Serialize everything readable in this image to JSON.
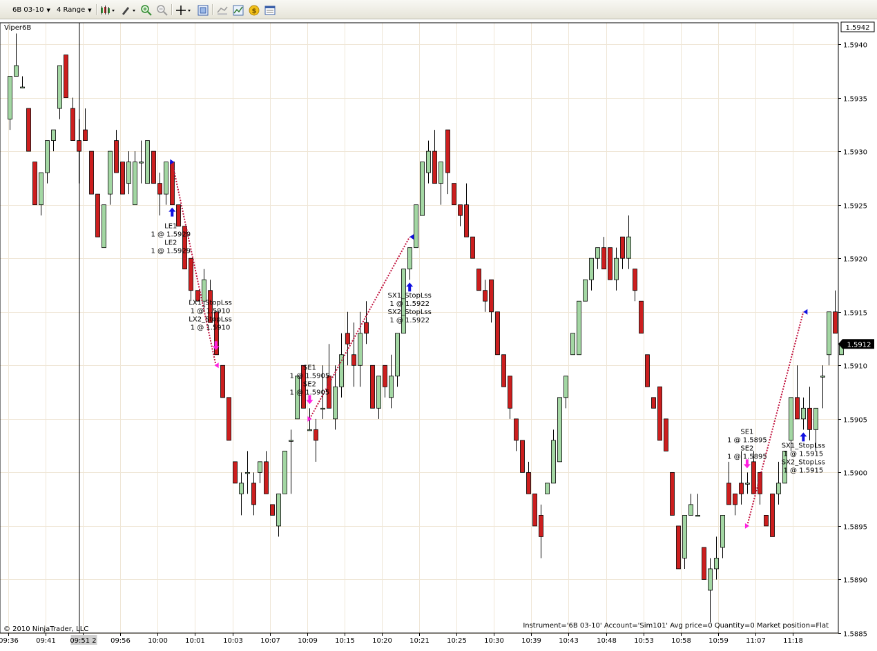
{
  "toolbar": {
    "instrument": "6B 03-10",
    "period": "4 Range"
  },
  "chart_title": "Viper6B",
  "colors": {
    "up_candle": "#a3d7a3",
    "down_candle": "#cc1e1e",
    "trade_line": "#c0103c",
    "long_marker": "#1010e0",
    "short_marker": "#ff20e0",
    "grid": "#efe6d6"
  },
  "chart_data": {
    "type": "candlestick",
    "price_axis": {
      "ylim": [
        1.5885,
        1.5942
      ],
      "ticks": [
        "1.5885",
        "1.5890",
        "1.5895",
        "1.5900",
        "1.5905",
        "1.5910",
        "1.5915",
        "1.5920",
        "1.5925",
        "1.5930",
        "1.5935",
        "1.5940"
      ],
      "top_label": "1.5942",
      "last_price_label": "1.5912",
      "last_price": 1.5912
    },
    "time_axis": {
      "ticks": [
        "09:36",
        "09:41",
        "09:51 2",
        "09:56",
        "10:00",
        "10:01",
        "10:03",
        "10:07",
        "10:09",
        "10:15",
        "10:20",
        "10:21",
        "10:25",
        "10:30",
        "10:39",
        "10:43",
        "10:48",
        "10:53",
        "10:58",
        "10:59",
        "11:07",
        "11:18"
      ]
    },
    "series": [
      {
        "name": "6B 03-10",
        "ohlc": [
          [
            1.5933,
            1.5937,
            1.5932,
            1.5937
          ],
          [
            1.5937,
            1.5941,
            1.5937,
            1.5938
          ],
          [
            1.5936,
            1.5937,
            1.5936,
            1.5936
          ],
          [
            1.5934,
            1.5934,
            1.593,
            1.593
          ],
          [
            1.5929,
            1.5929,
            1.5925,
            1.5925
          ],
          [
            1.5925,
            1.5928,
            1.5924,
            1.5928
          ],
          [
            1.5928,
            1.5931,
            1.5927,
            1.5931
          ],
          [
            1.5931,
            1.5932,
            1.593,
            1.5932
          ],
          [
            1.5934,
            1.5938,
            1.5933,
            1.5938
          ],
          [
            1.5939,
            1.5939,
            1.5935,
            1.5935
          ],
          [
            1.5934,
            1.5935,
            1.5931,
            1.5931
          ],
          [
            1.5931,
            1.5933,
            1.5927,
            1.593
          ],
          [
            1.5932,
            1.5934,
            1.5931,
            1.5931
          ],
          [
            1.593,
            1.5929,
            1.5926,
            1.5926
          ],
          [
            1.5926,
            1.5926,
            1.5922,
            1.5922
          ],
          [
            1.5921,
            1.5925,
            1.5921,
            1.5925
          ],
          [
            1.5926,
            1.593,
            1.5925,
            1.593
          ],
          [
            1.5931,
            1.5932,
            1.5928,
            1.5928
          ],
          [
            1.5929,
            1.5929,
            1.5926,
            1.5926
          ],
          [
            1.5927,
            1.593,
            1.5926,
            1.5929
          ],
          [
            1.5925,
            1.593,
            1.5925,
            1.5929
          ],
          [
            1.5929,
            1.5931,
            1.5927,
            1.5929
          ],
          [
            1.5927,
            1.5931,
            1.5927,
            1.5931
          ],
          [
            1.593,
            1.593,
            1.5927,
            1.5927
          ],
          [
            1.5927,
            1.5928,
            1.5924,
            1.5926
          ],
          [
            1.5926,
            1.5929,
            1.5925,
            1.5929
          ],
          [
            1.5929,
            1.5929,
            1.5925,
            1.5925
          ],
          [
            1.5925,
            1.5925,
            1.5923,
            1.5923
          ],
          [
            1.5923,
            1.5923,
            1.5919,
            1.5919
          ],
          [
            1.592,
            1.5919,
            1.5916,
            1.5917
          ],
          [
            1.5917,
            1.5917,
            1.5916,
            1.5916
          ],
          [
            1.5916,
            1.5919,
            1.5915,
            1.5918
          ],
          [
            1.5917,
            1.5918,
            1.5914,
            1.5914
          ],
          [
            1.5915,
            1.5915,
            1.5911,
            1.5911
          ],
          [
            1.591,
            1.591,
            1.5907,
            1.5907
          ],
          [
            1.5907,
            1.5907,
            1.5903,
            1.5903
          ],
          [
            1.5901,
            1.5901,
            1.5899,
            1.5899
          ],
          [
            1.5898,
            1.59,
            1.5896,
            1.5899
          ],
          [
            1.59,
            1.5902,
            1.5898,
            1.59
          ],
          [
            1.5899,
            1.59,
            1.5896,
            1.5897
          ],
          [
            1.59,
            1.5901,
            1.5899,
            1.5901
          ],
          [
            1.5901,
            1.5902,
            1.5898,
            1.5898
          ],
          [
            1.5897,
            1.5897,
            1.5896,
            1.5896
          ],
          [
            1.5895,
            1.5898,
            1.5894,
            1.5898
          ],
          [
            1.5898,
            1.5902,
            1.5898,
            1.5902
          ],
          [
            1.5903,
            1.5904,
            1.5898,
            1.5903
          ],
          [
            1.5905,
            1.5909,
            1.5905,
            1.5909
          ],
          [
            1.591,
            1.591,
            1.5906,
            1.5906
          ],
          [
            1.5904,
            1.5906,
            1.5904,
            1.5904
          ],
          [
            1.5904,
            1.5905,
            1.5901,
            1.5903
          ],
          [
            1.5906,
            1.591,
            1.5905,
            1.5906
          ],
          [
            1.5909,
            1.5912,
            1.5906,
            1.5906
          ],
          [
            1.5905,
            1.591,
            1.5904,
            1.5908
          ],
          [
            1.5908,
            1.5913,
            1.5907,
            1.5911
          ],
          [
            1.5913,
            1.5915,
            1.591,
            1.5912
          ],
          [
            1.5911,
            1.5914,
            1.5908,
            1.591
          ],
          [
            1.591,
            1.5915,
            1.5908,
            1.5913
          ],
          [
            1.5914,
            1.5916,
            1.5912,
            1.5913
          ],
          [
            1.591,
            1.591,
            1.5906,
            1.5906
          ],
          [
            1.5906,
            1.5909,
            1.5905,
            1.5909
          ],
          [
            1.591,
            1.591,
            1.5907,
            1.5908
          ],
          [
            1.5907,
            1.5911,
            1.5906,
            1.5909
          ],
          [
            1.5909,
            1.5913,
            1.5908,
            1.5913
          ],
          [
            1.5913,
            1.5919,
            1.5913,
            1.5919
          ],
          [
            1.5919,
            1.5921,
            1.5918,
            1.5921
          ],
          [
            1.5921,
            1.5925,
            1.5921,
            1.5925
          ],
          [
            1.5924,
            1.5928,
            1.5924,
            1.5929
          ],
          [
            1.5928,
            1.5931,
            1.5927,
            1.593
          ],
          [
            1.593,
            1.5932,
            1.5927,
            1.5927
          ],
          [
            1.5927,
            1.5929,
            1.5925,
            1.5929
          ],
          [
            1.5932,
            1.5932,
            1.5926,
            1.5928
          ],
          [
            1.5927,
            1.5927,
            1.5925,
            1.5925
          ],
          [
            1.5925,
            1.5925,
            1.5923,
            1.5924
          ],
          [
            1.5925,
            1.5927,
            1.5922,
            1.5922
          ],
          [
            1.5922,
            1.5922,
            1.592,
            1.592
          ],
          [
            1.5919,
            1.5919,
            1.5917,
            1.5917
          ],
          [
            1.5917,
            1.5918,
            1.5915,
            1.5916
          ],
          [
            1.5918,
            1.5918,
            1.5914,
            1.5915
          ],
          [
            1.5915,
            1.5915,
            1.5911,
            1.5911
          ],
          [
            1.5911,
            1.5911,
            1.5908,
            1.5908
          ],
          [
            1.5909,
            1.5909,
            1.5905,
            1.5906
          ],
          [
            1.5905,
            1.5905,
            1.5902,
            1.5903
          ],
          [
            1.5903,
            1.5903,
            1.5901,
            1.59
          ],
          [
            1.59,
            1.5901,
            1.5899,
            1.5898
          ],
          [
            1.5898,
            1.5898,
            1.5895,
            1.5895
          ],
          [
            1.5896,
            1.5897,
            1.5892,
            1.5894
          ],
          [
            1.5898,
            1.5898,
            1.5898,
            1.5899
          ],
          [
            1.5899,
            1.5904,
            1.5899,
            1.5903
          ],
          [
            1.5901,
            1.5907,
            1.5901,
            1.5907
          ],
          [
            1.5907,
            1.5909,
            1.5906,
            1.5909
          ],
          [
            1.5911,
            1.5911,
            1.5911,
            1.5913
          ],
          [
            1.5911,
            1.5911,
            1.5914,
            1.5916
          ],
          [
            1.5916,
            1.5918,
            1.5916,
            1.5918
          ],
          [
            1.5918,
            1.592,
            1.5917,
            1.592
          ],
          [
            1.592,
            1.5921,
            1.5919,
            1.5921
          ],
          [
            1.5921,
            1.5922,
            1.5919,
            1.5919
          ],
          [
            1.5921,
            1.5921,
            1.5918,
            1.5918
          ],
          [
            1.5918,
            1.5921,
            1.5917,
            1.592
          ],
          [
            1.5922,
            1.5922,
            1.5919,
            1.592
          ],
          [
            1.592,
            1.5924,
            1.5919,
            1.5922
          ],
          [
            1.5919,
            1.5919,
            1.5916,
            1.5917
          ],
          [
            1.5916,
            1.5916,
            1.5913,
            1.5913
          ],
          [
            1.5911,
            1.5911,
            1.5908,
            1.5908
          ],
          [
            1.5907,
            1.5907,
            1.5906,
            1.5906
          ],
          [
            1.5908,
            1.5908,
            1.5903,
            1.5903
          ],
          [
            1.5905,
            1.5905,
            1.5902,
            1.5902
          ],
          [
            1.59,
            1.59,
            1.5896,
            1.5896
          ],
          [
            1.5895,
            1.5895,
            1.5891,
            1.5891
          ],
          [
            1.5892,
            1.5896,
            1.5891,
            1.5896
          ],
          [
            1.5896,
            1.5898,
            1.5896,
            1.5897
          ],
          [
            1.5896,
            1.5898,
            1.5896,
            1.5896
          ],
          [
            1.5893,
            1.5893,
            1.589,
            1.589
          ],
          [
            1.5889,
            1.5892,
            1.5886,
            1.5891
          ],
          [
            1.5891,
            1.5894,
            1.589,
            1.5892
          ],
          [
            1.5893,
            1.5896,
            1.5892,
            1.5896
          ],
          [
            1.5899,
            1.5901,
            1.5897,
            1.5897
          ],
          [
            1.5898,
            1.5898,
            1.5896,
            1.5897
          ],
          [
            1.5899,
            1.5902,
            1.5897,
            1.5898
          ],
          [
            1.5899,
            1.59,
            1.5898,
            1.5899
          ],
          [
            1.5901,
            1.5902,
            1.5898,
            1.5898
          ],
          [
            1.59,
            1.59,
            1.5897,
            1.5898
          ],
          [
            1.5896,
            1.5896,
            1.5895,
            1.5895
          ],
          [
            1.5898,
            1.5898,
            1.5894,
            1.5894
          ],
          [
            1.5898,
            1.5901,
            1.5897,
            1.5899
          ],
          [
            1.5899,
            1.5902,
            1.5899,
            1.5902
          ],
          [
            1.5903,
            1.5907,
            1.5902,
            1.5907
          ],
          [
            1.5907,
            1.591,
            1.5905,
            1.5905
          ],
          [
            1.5905,
            1.5907,
            1.5904,
            1.5906
          ],
          [
            1.5906,
            1.5908,
            1.5903,
            1.5904
          ],
          [
            1.5904,
            1.5906,
            1.5902,
            1.5906
          ],
          [
            1.5909,
            1.591,
            1.5906,
            1.5909
          ],
          [
            1.5911,
            1.5915,
            1.591,
            1.5915
          ],
          [
            1.5915,
            1.5917,
            1.5914,
            1.5913
          ],
          [
            1.5911,
            1.5912,
            1.5911,
            1.5912
          ]
        ]
      }
    ],
    "trades": [
      {
        "entry_signal": "LE1",
        "entry_label": "1 @ 1.5929",
        "entry2_signal": "LE2",
        "entry2_label": "1 @ 1.5929",
        "exit_signal": "LX1_StopLss",
        "exit_label": "1 @ 1.5910",
        "exit2_signal": "LX2_StopLss",
        "exit2_label": "1 @ 1.5910",
        "entry_price": 1.5929,
        "exit_price": 1.591
      },
      {
        "entry_signal": "SE1",
        "entry_label": "1 @ 1.5905",
        "entry2_signal": "SE2",
        "entry2_label": "1 @ 1.5905",
        "exit_signal": "SX1_StopLss",
        "exit_label": "1 @ 1.5922",
        "exit2_signal": "SX2_StopLss",
        "exit2_label": "1 @ 1.5922",
        "entry_price": 1.5905,
        "exit_price": 1.5922
      },
      {
        "entry_signal": "SE1",
        "entry_label": "1 @ 1.5895",
        "entry2_signal": "SE2",
        "entry2_label": "1 @ 1.5895",
        "exit_signal": "SX1_StopLss",
        "exit_label": "1 @ 1.5915",
        "exit2_signal": "SX2_StopLss",
        "exit2_label": "1 @ 1.5915",
        "entry_price": 1.5895,
        "exit_price": 1.5915
      }
    ]
  },
  "status_text": "Instrument='6B 03-10' Account='Sim101' Avg price=0 Quantity=0 Market position=Flat",
  "copyright": "© 2010 NinjaTrader, LLC"
}
